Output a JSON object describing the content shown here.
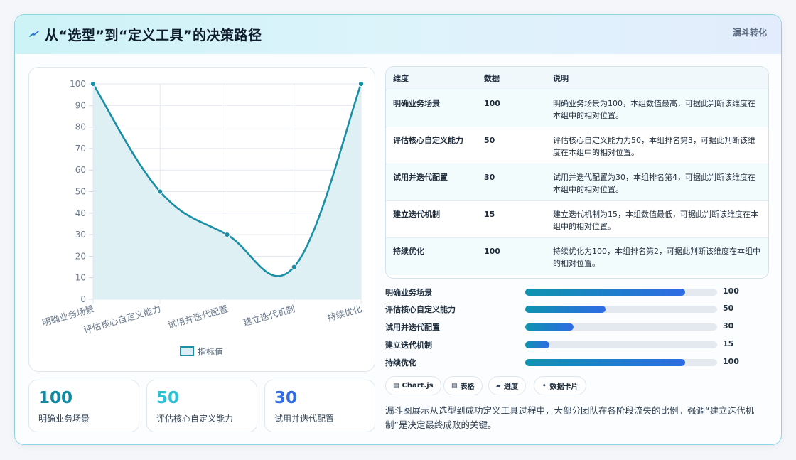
{
  "header": {
    "title": "从“选型”到“定义工具”的决策路径",
    "badge": "漏斗转化"
  },
  "colors": {
    "line": "#1a8fa5",
    "area": "#dbeef4",
    "bar_start": "#0e93ae",
    "bar_end": "#2e6be4",
    "stat_1": "#0e8aa3",
    "stat_2": "#2ac3d8",
    "stat_3": "#2e6be4"
  },
  "chart_data": {
    "type": "line",
    "categories": [
      "明确业务场景",
      "评估核心自定义能力",
      "试用并迭代配置",
      "建立迭代机制",
      "持续优化"
    ],
    "series": [
      {
        "name": "指标值",
        "values": [
          100,
          50,
          30,
          15,
          100
        ]
      }
    ],
    "ylim": [
      0,
      100
    ],
    "yticks": [
      0,
      10,
      20,
      30,
      40,
      50,
      60,
      70,
      80,
      90,
      100
    ],
    "grid": true,
    "fill": true,
    "legend": "bottom"
  },
  "stats": [
    {
      "value": "100",
      "label": "明确业务场景"
    },
    {
      "value": "50",
      "label": "评估核心自定义能力"
    },
    {
      "value": "30",
      "label": "试用并迭代配置"
    }
  ],
  "table": {
    "headers": [
      "维度",
      "数据",
      "说明"
    ],
    "rows": [
      [
        "明确业务场景",
        "100",
        "明确业务场景为100，本组数值最高，可据此判断该维度在本组中的相对位置。"
      ],
      [
        "评估核心自定义能力",
        "50",
        "评估核心自定义能力为50，本组排名第3，可据此判断该维度在本组中的相对位置。"
      ],
      [
        "试用并迭代配置",
        "30",
        "试用并迭代配置为30，本组排名第4，可据此判断该维度在本组中的相对位置。"
      ],
      [
        "建立迭代机制",
        "15",
        "建立迭代机制为15，本组数值最低，可据此判断该维度在本组中的相对位置。"
      ],
      [
        "持续优化",
        "100",
        "持续优化为100，本组排名第2，可据此判断该维度在本组中的相对位置。"
      ]
    ]
  },
  "bars": [
    {
      "label": "明确业务场景",
      "value": 100,
      "value_text": "100"
    },
    {
      "label": "评估核心自定义能力",
      "value": 50,
      "value_text": "50"
    },
    {
      "label": "试用并迭代配置",
      "value": 30,
      "value_text": "30"
    },
    {
      "label": "建立迭代机制",
      "value": 15,
      "value_text": "15"
    },
    {
      "label": "持续优化",
      "value": 100,
      "value_text": "100"
    }
  ],
  "chips": [
    {
      "icon": "chart-icon",
      "label": "Chart.js"
    },
    {
      "icon": "table-icon",
      "label": "表格"
    },
    {
      "icon": "progress-icon",
      "label": "进度"
    },
    {
      "icon": "sparkle-icon",
      "label": "数据卡片"
    }
  ],
  "description": "漏斗图展示从选型到成功定义工具过程中，大部分团队在各阶段流失的比例。强调“建立迭代机制”是决定最终成败的关键。"
}
